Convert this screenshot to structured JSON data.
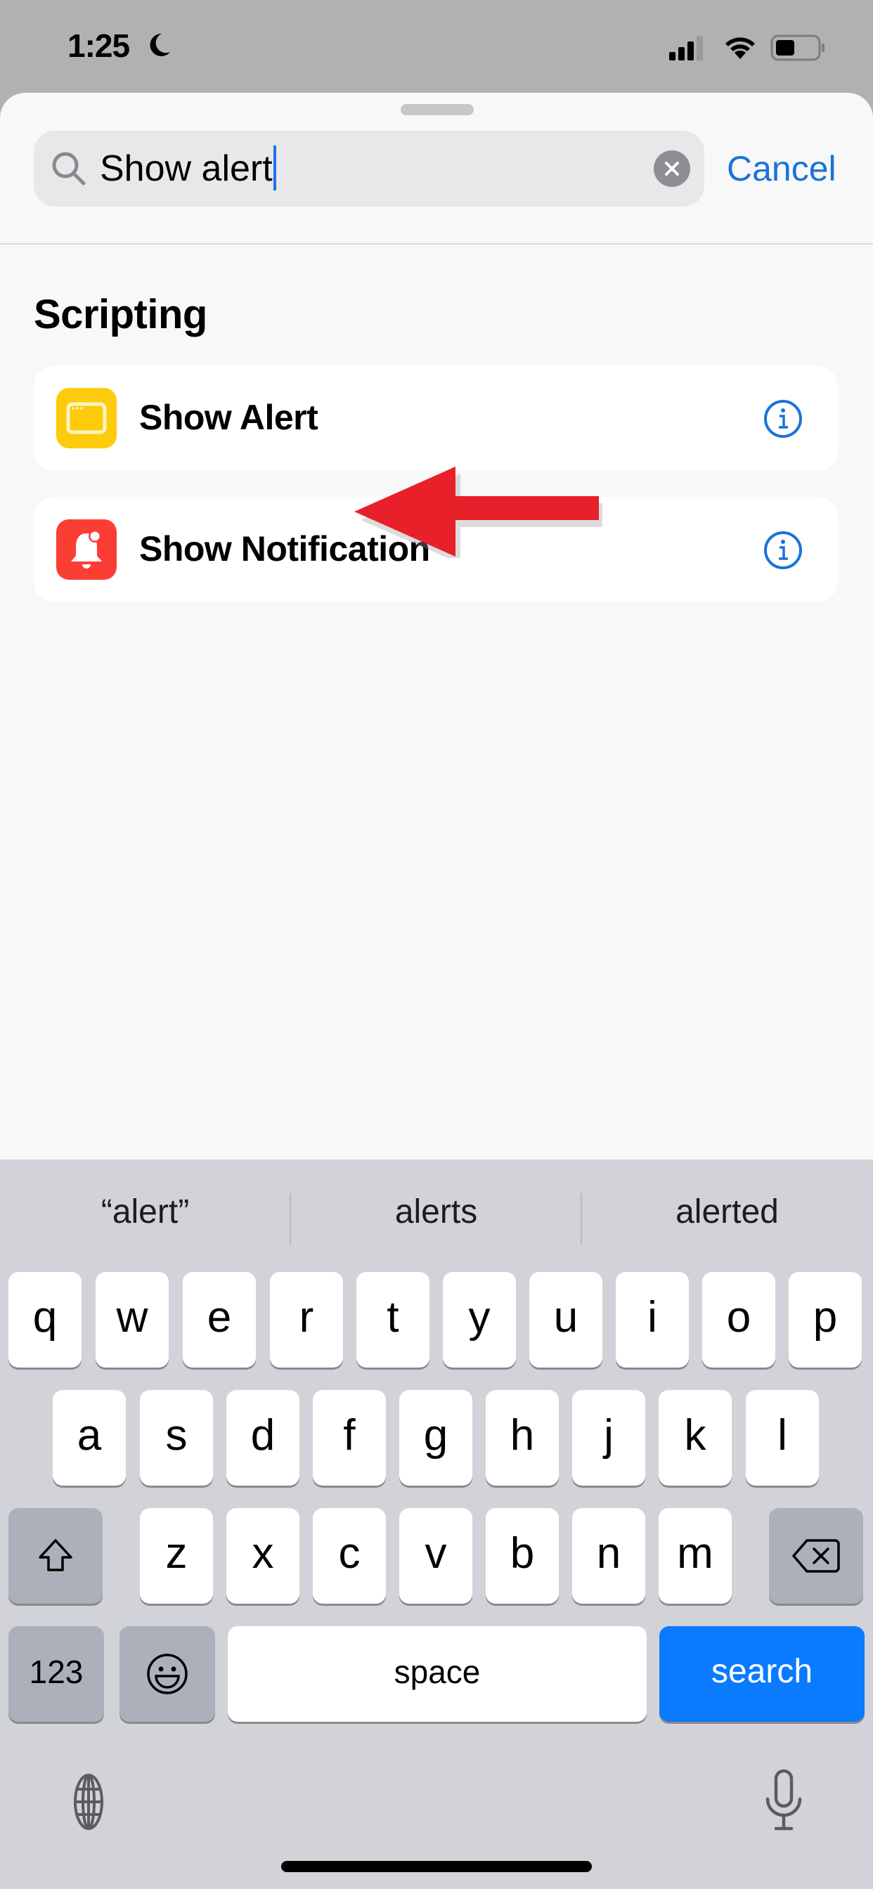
{
  "status_bar": {
    "time": "1:25",
    "focus_mode_icon": "moon-icon",
    "signal_icon": "cellular-signal-icon",
    "wifi_icon": "wifi-icon",
    "battery_icon": "battery-icon",
    "battery_level": 0.45
  },
  "search": {
    "icon": "search-icon",
    "value": "Show alert",
    "clear_icon": "clear-icon",
    "cancel_label": "Cancel"
  },
  "results": {
    "section_title": "Scripting",
    "items": [
      {
        "label": "Show Alert",
        "icon": "alert-window-icon",
        "icon_color": "#fdcb0b",
        "info_icon": "info-icon"
      },
      {
        "label": "Show Notification",
        "icon": "notification-bell-icon",
        "icon_color": "#fb3e34",
        "info_icon": "info-icon"
      }
    ]
  },
  "annotation": {
    "arrow_icon": "red-arrow-icon",
    "color": "#e8202a",
    "points_to": "Show Alert"
  },
  "keyboard": {
    "suggestions": [
      "“alert”",
      "alerts",
      "alerted"
    ],
    "row1": [
      "q",
      "w",
      "e",
      "r",
      "t",
      "y",
      "u",
      "i",
      "o",
      "p"
    ],
    "row2": [
      "a",
      "s",
      "d",
      "f",
      "g",
      "h",
      "j",
      "k",
      "l"
    ],
    "row3": [
      "z",
      "x",
      "c",
      "v",
      "b",
      "n",
      "m"
    ],
    "shift_icon": "shift-icon",
    "delete_icon": "delete-icon",
    "numbers_label": "123",
    "emoji_icon": "emoji-icon",
    "space_label": "space",
    "search_label": "search",
    "globe_icon": "globe-icon",
    "mic_icon": "microphone-icon",
    "accent_color": "#0a7aff"
  }
}
